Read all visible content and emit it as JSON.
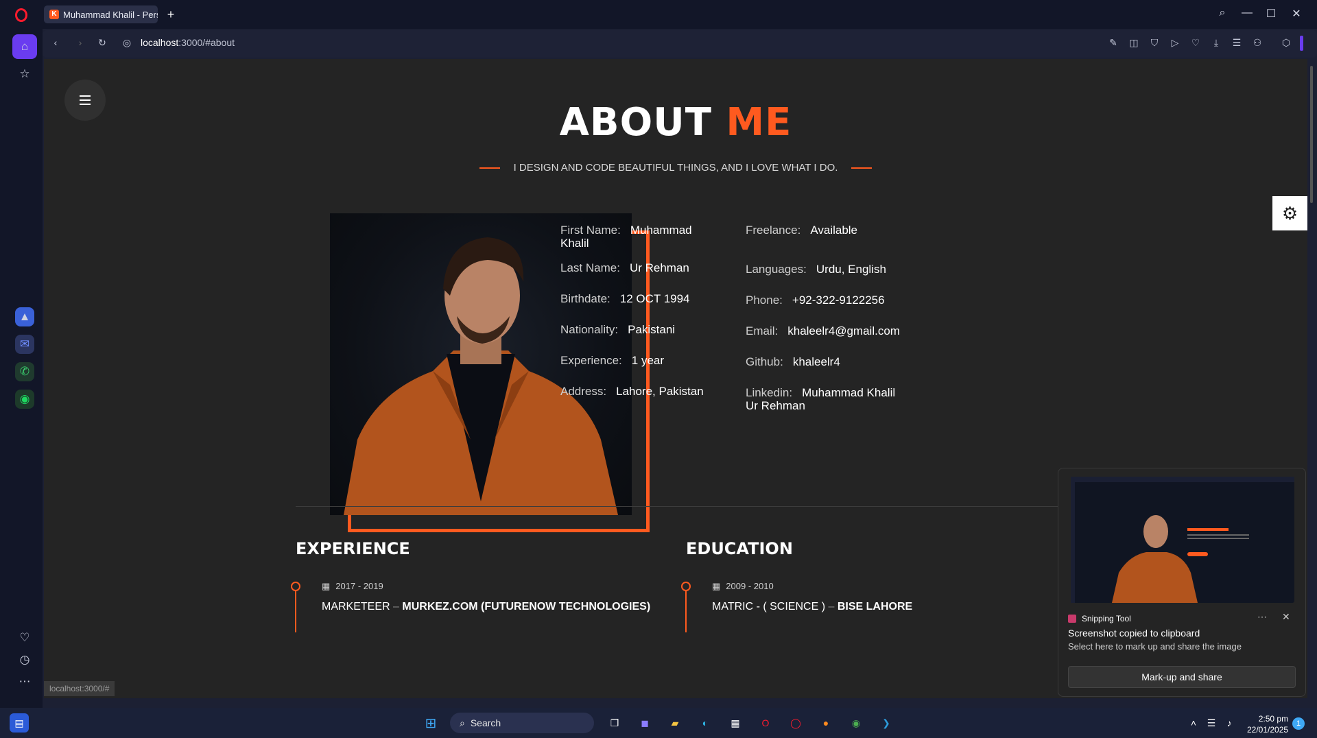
{
  "browser": {
    "tab_title": "Muhammad Khalil - Perso",
    "new_tab": "+",
    "address_host": "localhost",
    "address_rest": ":3000/#about",
    "status_url": "localhost:3000/#"
  },
  "page": {
    "heading_part1": "ABOUT",
    "heading_part2": "ME",
    "tagline": "I DESIGN AND CODE BEAUTIFUL THINGS, AND I LOVE WHAT I DO.",
    "accent_color": "#ff5a1f",
    "info_left": [
      {
        "label": "First Name:",
        "value": "Muhammad Khalil"
      },
      {
        "label": "Last Name:",
        "value": "Ur Rehman"
      },
      {
        "label": "Birthdate:",
        "value": "12 OCT 1994"
      },
      {
        "label": "Nationality:",
        "value": "Pakistani"
      },
      {
        "label": "Experience:",
        "value": "1 year"
      },
      {
        "label": "Address:",
        "value": "Lahore, Pakistan"
      }
    ],
    "info_right": [
      {
        "label": "Freelance:",
        "value": "Available"
      },
      {
        "label": "Languages:",
        "value": "Urdu, English"
      },
      {
        "label": "Phone:",
        "value": "+92-322-9122256"
      },
      {
        "label": "Email:",
        "value": "khaleelr4@gmail.com"
      },
      {
        "label": "Github:",
        "value": "khaleelr4"
      },
      {
        "label": "Linkedin:",
        "value": "Muhammad Khalil Ur Rehman"
      }
    ],
    "experience": {
      "title": "EXPERIENCE",
      "date": "2017 - 2019",
      "role": "MARKETEER",
      "org": "MURKEZ.COM (FUTURENOW TECHNOLOGIES)"
    },
    "education": {
      "title": "EDUCATION",
      "date": "2009 - 2010",
      "role": "MATRIC - ( SCIENCE )",
      "org": "BISE LAHORE"
    }
  },
  "toast": {
    "app": "Snipping Tool",
    "line1": "Screenshot copied to clipboard",
    "line2": "Select here to mark up and share the image",
    "button": "Mark-up and share"
  },
  "taskbar": {
    "search": "Search",
    "time": "2:50 pm",
    "date": "22/01/2025",
    "notif": "1"
  }
}
